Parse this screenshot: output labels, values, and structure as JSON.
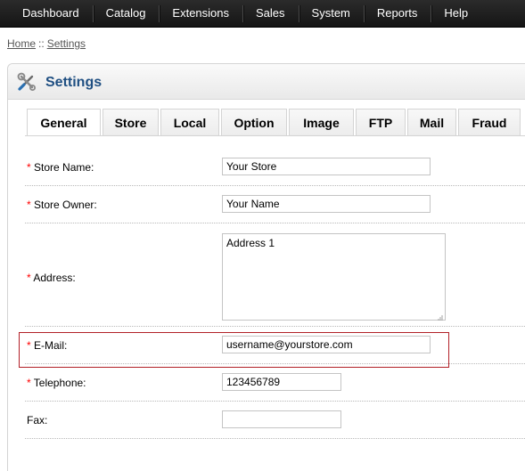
{
  "nav": {
    "items": [
      {
        "label": "Dashboard"
      },
      {
        "label": "Catalog"
      },
      {
        "label": "Extensions"
      },
      {
        "label": "Sales"
      },
      {
        "label": "System"
      },
      {
        "label": "Reports"
      },
      {
        "label": "Help"
      }
    ]
  },
  "breadcrumb": {
    "home": "Home",
    "separator": "::",
    "current": "Settings"
  },
  "page": {
    "title": "Settings",
    "icon": "tools-icon"
  },
  "tabs": [
    {
      "label": "General",
      "active": true
    },
    {
      "label": "Store"
    },
    {
      "label": "Local"
    },
    {
      "label": "Option"
    },
    {
      "label": "Image"
    },
    {
      "label": "FTP"
    },
    {
      "label": "Mail"
    },
    {
      "label": "Fraud"
    }
  ],
  "form": {
    "required_mark": "*",
    "store_name": {
      "label": "Store Name:",
      "value": "Your Store",
      "required": true
    },
    "store_owner": {
      "label": "Store Owner:",
      "value": "Your Name",
      "required": true
    },
    "address": {
      "label": "Address:",
      "value": "Address 1",
      "required": true
    },
    "email": {
      "label": "E-Mail:",
      "value": "username@yourstore.com",
      "required": true
    },
    "telephone": {
      "label": "Telephone:",
      "value": "123456789",
      "required": true
    },
    "fax": {
      "label": "Fax:",
      "value": "",
      "required": false
    }
  },
  "colors": {
    "nav_bg": "#1c1c1c",
    "title": "#1f4f82",
    "required": "#ff0000",
    "highlight_border": "#b22027"
  }
}
